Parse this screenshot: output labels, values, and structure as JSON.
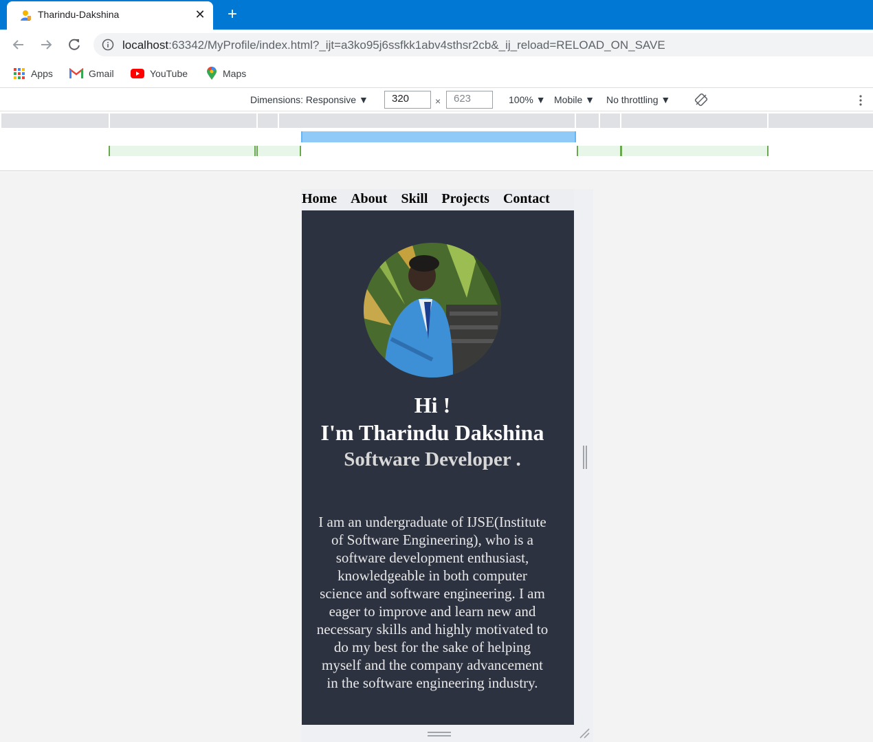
{
  "browser": {
    "tab": {
      "title": "Tharindu-Dakshina",
      "close": "✕"
    },
    "new_tab": "+",
    "url": {
      "host": "localhost",
      "rest": ":63342/MyProfile/index.html?_ijt=a3ko95j6ssfkk1abv4sthsr2cb&_ij_reload=RELOAD_ON_SAVE"
    },
    "bookmarks": [
      {
        "label": "Apps",
        "icon": "apps-grid-icon"
      },
      {
        "label": "Gmail",
        "icon": "gmail-icon"
      },
      {
        "label": "YouTube",
        "icon": "youtube-icon"
      },
      {
        "label": "Maps",
        "icon": "maps-pin-icon"
      }
    ]
  },
  "devtools": {
    "dimensions": "Dimensions: Responsive ▼",
    "width": "320",
    "height": "623",
    "times": "×",
    "zoom": "100% ▼",
    "device_type": "Mobile ▼",
    "throttling": "No throttling ▼"
  },
  "site": {
    "nav": [
      "Home",
      "About",
      "Skill",
      "Projects",
      "Contact"
    ],
    "greeting_1": "Hi !",
    "greeting_2": "I'm Tharindu Dakshina",
    "role": "Software Developer .",
    "bio": "I am an undergraduate of IJSE(Institute of Software Engineering), who is a software development enthusiast, knowledgeable in both computer science and software engineering. I am eager to improve and learn new and necessary skills and highly motivated to do my best for the sake of helping myself and the company advancement in the software engineering industry."
  },
  "colors": {
    "tabstrip": "#0078d4",
    "hero_bg": "#2d3241",
    "nav_bg": "#eceef1"
  }
}
